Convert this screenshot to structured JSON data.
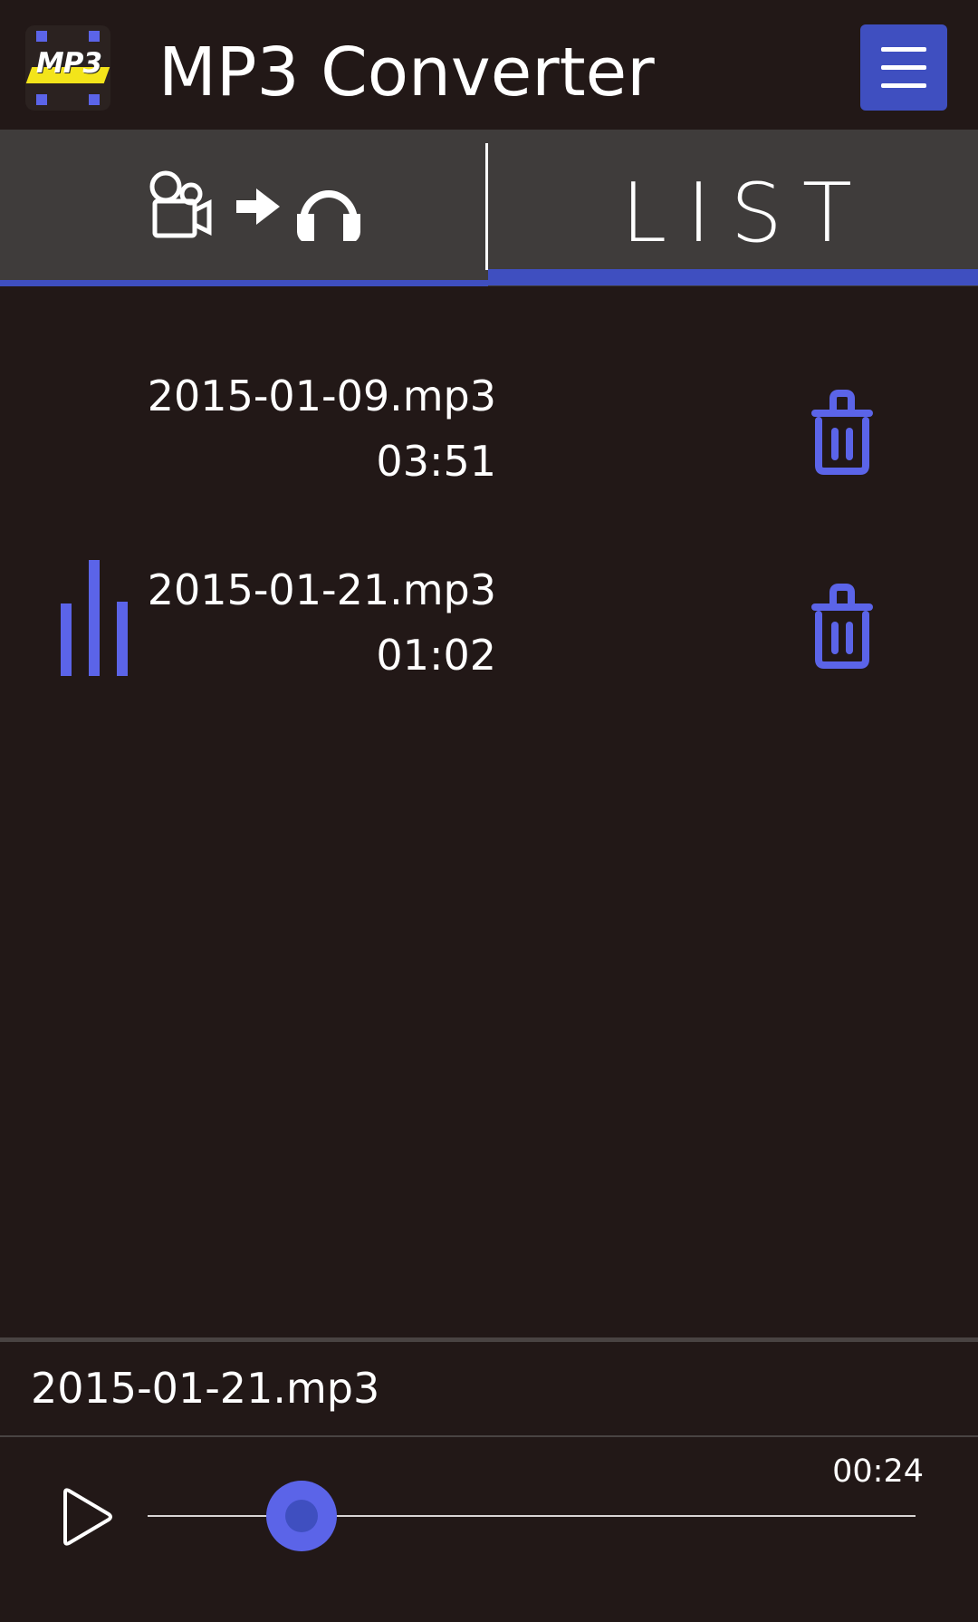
{
  "header": {
    "title": "MP3 Converter",
    "logo_text": "MP3",
    "menu_icon": "hamburger-menu-icon"
  },
  "tabs": [
    {
      "icons": [
        "video-camera-icon",
        "arrow-right-icon",
        "headphones-icon"
      ],
      "selected": false
    },
    {
      "label": "LIST",
      "selected": true
    }
  ],
  "files": [
    {
      "name": "2015-01-09.mp3",
      "duration": "03:51",
      "playing": false
    },
    {
      "name": "2015-01-21.mp3",
      "duration": "01:02",
      "playing": true
    }
  ],
  "player": {
    "current_file": "2015-01-21.mp3",
    "elapsed": "00:24",
    "progress_fraction": 0.2
  },
  "colors": {
    "background": "#221817",
    "tab_background": "#3f3c3b",
    "accent": "#5b64e8",
    "accent_dark": "#3f4fc0",
    "logo_yellow": "#f3e41a"
  }
}
